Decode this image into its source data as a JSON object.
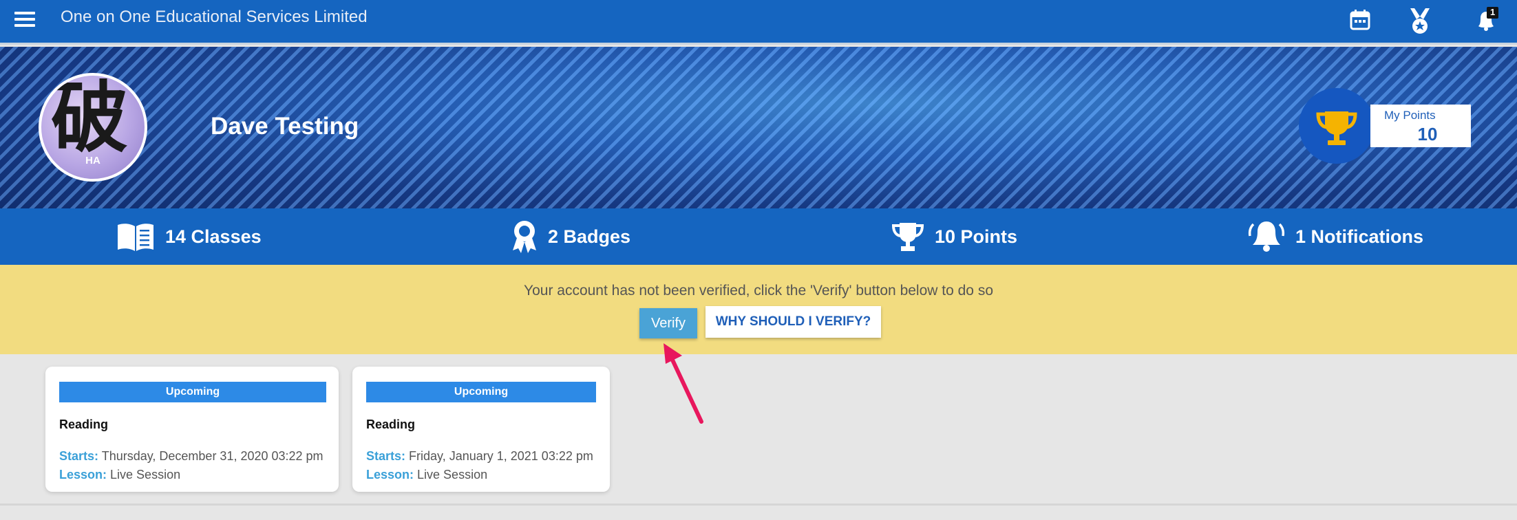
{
  "app": {
    "title": "One on One Educational Services Limited"
  },
  "topbar": {
    "icons": [
      "menu-icon",
      "calendar-icon",
      "medal-icon",
      "bell-icon"
    ],
    "notification_badge": "1"
  },
  "profile": {
    "name": "Dave Testing",
    "avatar_glyph": "破",
    "avatar_tag": "HA",
    "points_label": "My Points",
    "points_value": "10"
  },
  "stats": [
    {
      "label": "14 Classes",
      "icon": "book-icon"
    },
    {
      "label": "2 Badges",
      "icon": "badge-icon"
    },
    {
      "label": "10 Points",
      "icon": "trophy-icon"
    },
    {
      "label": "1 Notifications",
      "icon": "bell-icon"
    }
  ],
  "verification": {
    "message": "Your account has not been verified, click the 'Verify' button below to do so",
    "verify_label": "Verify",
    "why_label": "WHY SHOULD I VERIFY?"
  },
  "classes": [
    {
      "status": "Upcoming",
      "subject": "Reading",
      "starts_key": "Starts:",
      "starts": "Thursday, December 31, 2020 03:22 pm",
      "lesson_key": "Lesson:",
      "lesson": "Live Session"
    },
    {
      "status": "Upcoming",
      "subject": "Reading",
      "starts_key": "Starts:",
      "starts": "Friday, January 1, 2021 03:22 pm",
      "lesson_key": "Lesson:",
      "lesson": "Live Session"
    }
  ],
  "colors": {
    "primary": "#1565c0",
    "banner": "#f2dc80",
    "verify": "#4aa3d6",
    "accent_arrow": "#e8175d",
    "trophy": "#f5b301"
  }
}
